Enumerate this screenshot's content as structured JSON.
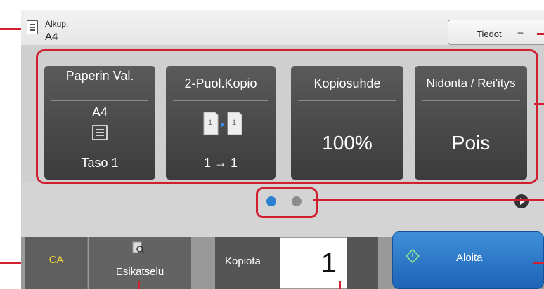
{
  "original": {
    "label": "Alkup.",
    "size": "A4",
    "icon": "document-icon"
  },
  "details_button": {
    "label": "Tiedot",
    "icon": "arrow-right-icon"
  },
  "cards": [
    {
      "title": "Paperin Val.",
      "value": "A4",
      "icon": "paper-tray-icon",
      "footer": "Taso 1"
    },
    {
      "title": "2-Puol.Kopio",
      "icon": "duplex-copy-icon",
      "footer": "1 → 1"
    },
    {
      "title": "Kopiosuhde",
      "value": "100%"
    },
    {
      "title": "Nidonta / Rei'itys",
      "value": "Pois"
    }
  ],
  "pager": {
    "current_page": 1,
    "total_pages": 2,
    "colors": {
      "active": "#2a7fd0",
      "inactive": "#8c8c8c"
    },
    "next_icon": "next-page-icon"
  },
  "bottom": {
    "ca_label": "CA",
    "preview_label": "Esikatselu",
    "preview_icon": "preview-icon",
    "copies_label": "Kopiota",
    "copies_value": "1",
    "start_label": "Aloita",
    "start_icon": "start-icon"
  },
  "colors": {
    "callout": "#d0202f",
    "start": "#2a74c6",
    "ca_text": "#f2d23c"
  }
}
